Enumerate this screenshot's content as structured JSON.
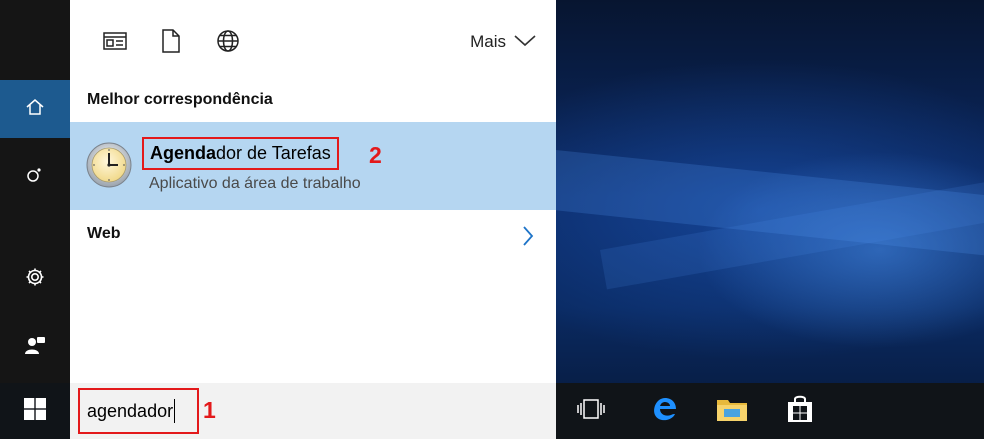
{
  "search_panel": {
    "filters": [
      {
        "icon": "apps-filter-icon"
      },
      {
        "icon": "documents-filter-icon"
      },
      {
        "icon": "web-filter-icon"
      }
    ],
    "more_label": "Mais",
    "best_match_header": "Melhor correspondência",
    "best_match": {
      "title_bold": "Agenda",
      "title_rest": "dor de Tarefas",
      "subtitle": "Aplicativo da área de trabalho",
      "icon": "task-scheduler-clock-icon"
    },
    "web_header": "Web"
  },
  "left_rail": {
    "items": [
      {
        "icon": "home-icon",
        "active": true
      },
      {
        "icon": "cortana-icon",
        "active": false
      },
      {
        "icon": "settings-gear-icon",
        "active": false
      },
      {
        "icon": "feedback-icon",
        "active": false
      }
    ]
  },
  "taskbar": {
    "search_value": "agendador",
    "apps": [
      "task-view-icon",
      "edge-icon",
      "file-explorer-icon",
      "store-icon"
    ]
  },
  "annotations": {
    "marker_1": "1",
    "marker_2": "2"
  },
  "colors": {
    "highlight": "#b5d6f1",
    "accent": "#1d5a8f",
    "annotation_red": "#e3191b"
  }
}
